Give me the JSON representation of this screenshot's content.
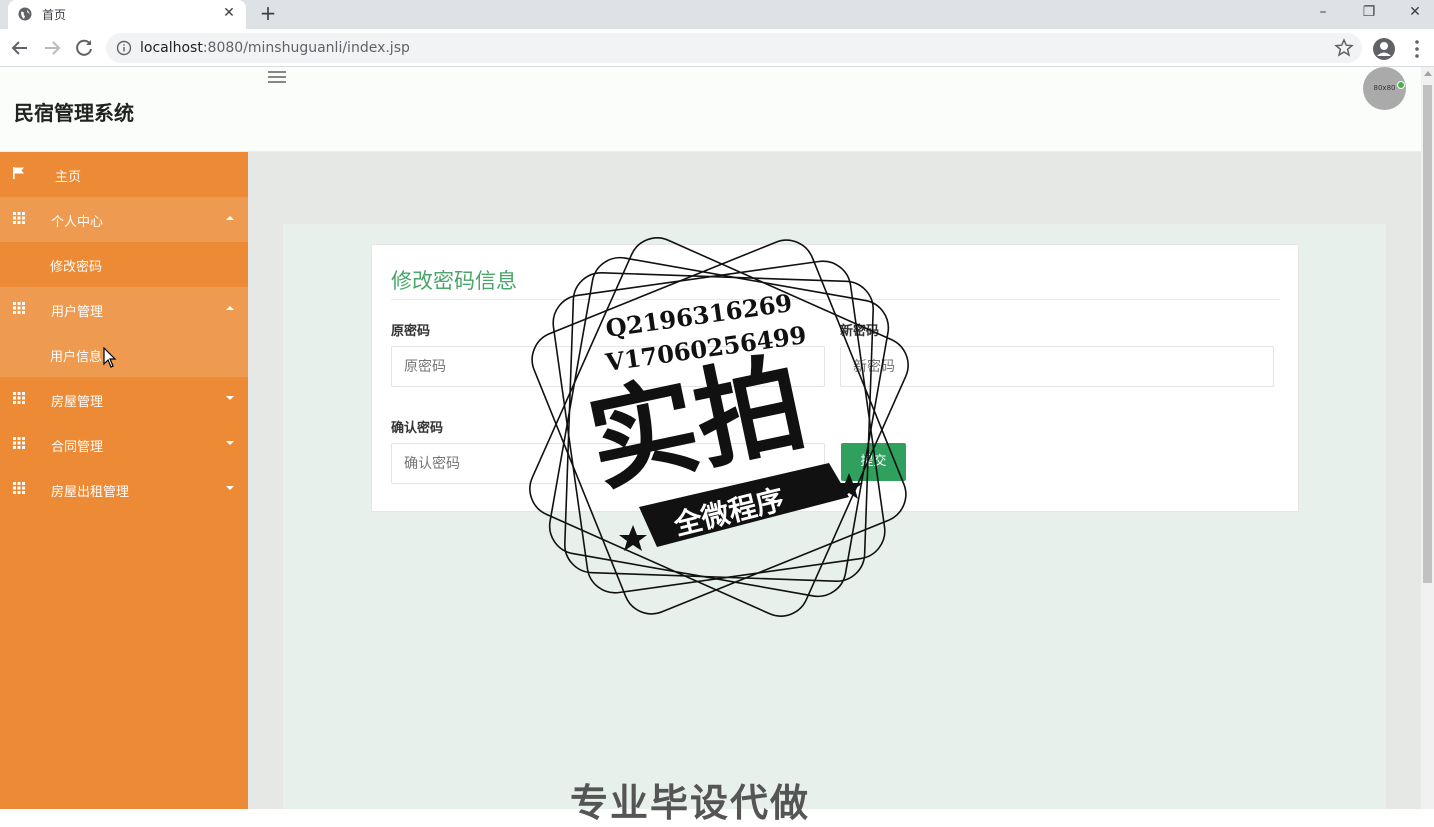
{
  "browser": {
    "tab_title": "首页",
    "tab_close": "✕",
    "new_tab": "+",
    "url_host": "localhost",
    "url_rest": ":8080/minshuguanli/index.jsp",
    "window_controls": {
      "minimize": "–",
      "restore": "❐",
      "close": "✕"
    }
  },
  "header": {
    "brand": "民宿管理系统",
    "avatar_text": "80x80"
  },
  "sidebar": {
    "items": [
      {
        "label": "主页",
        "icon": "flag-icon"
      },
      {
        "label": "个人中心",
        "icon": "grid-icon",
        "expanded": true
      },
      {
        "label": "修改密码",
        "sub": true
      },
      {
        "label": "用户管理",
        "icon": "grid-icon",
        "expanded": true
      },
      {
        "label": "用户信息",
        "sub": true
      },
      {
        "label": "房屋管理",
        "icon": "grid-icon"
      },
      {
        "label": "合同管理",
        "icon": "grid-icon"
      },
      {
        "label": "房屋出租管理",
        "icon": "grid-icon"
      }
    ]
  },
  "form": {
    "title": "修改密码信息",
    "old_password": {
      "label": "原密码",
      "placeholder": "原密码"
    },
    "new_password": {
      "label": "新密码",
      "placeholder": "新密码"
    },
    "confirm_password": {
      "label": "确认密码",
      "placeholder": "确认密码"
    },
    "submit_label": "提交"
  },
  "watermark": {
    "qq": "Q2196316269",
    "wechat": "V17060256499",
    "main": "实拍",
    "banner": "全微程序",
    "bottom_text": "专业毕设代做"
  },
  "colors": {
    "sidebar": "#ec8a35",
    "accent_green": "#4aa56a",
    "submit": "#2fa05e"
  }
}
